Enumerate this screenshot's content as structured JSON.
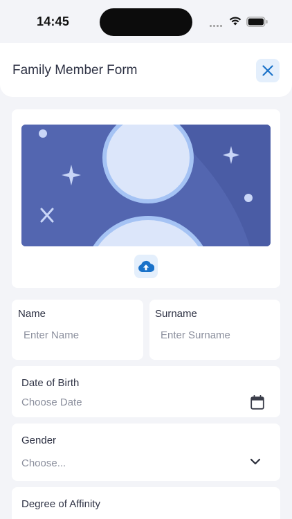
{
  "status_bar": {
    "time": "14:45",
    "icons": [
      "signal-icon",
      "wifi-icon",
      "battery-icon"
    ]
  },
  "header": {
    "title": "Family Member Form",
    "close_icon": "close-icon"
  },
  "avatar": {
    "placeholder_icon": "person-icon",
    "upload_icon": "cloud-upload-icon"
  },
  "form": {
    "name": {
      "label": "Name",
      "placeholder": "Enter Name"
    },
    "surname": {
      "label": "Surname",
      "placeholder": "Enter Surname"
    },
    "date_of_birth": {
      "label": "Date of Birth",
      "placeholder": "Choose Date",
      "icon": "calendar-icon"
    },
    "gender": {
      "label": "Gender",
      "placeholder": "Choose...",
      "icon": "chevron-down-icon"
    },
    "degree_of_affinity": {
      "label": "Degree of Affinity"
    }
  },
  "colors": {
    "accent": "#1A72C9",
    "banner": "#5366B0",
    "page_background": "#F3F4F8"
  }
}
